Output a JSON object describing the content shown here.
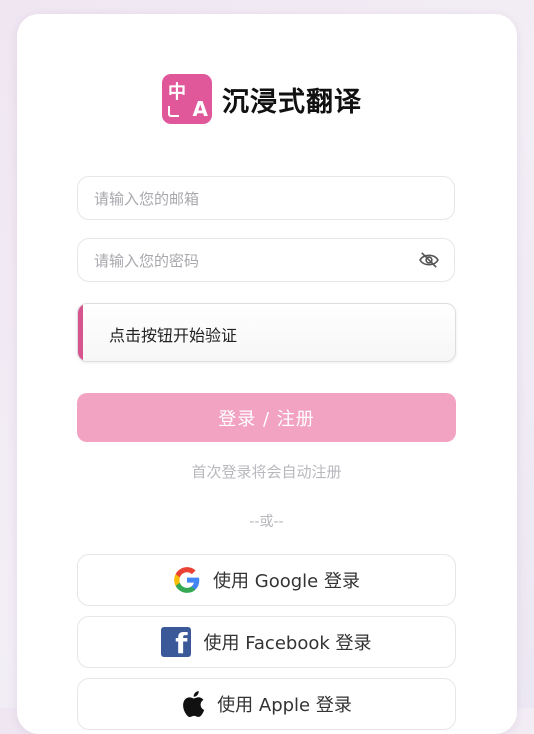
{
  "brand": {
    "logo_zh": "中",
    "logo_a": "A",
    "name": "沉浸式翻译"
  },
  "form": {
    "email_placeholder": "请输入您的邮箱",
    "password_placeholder": "请输入您的密码",
    "verify_label": "点击按钮开始验证",
    "submit_label": "登录 / 注册",
    "hint": "首次登录将会自动注册",
    "divider": "--或--"
  },
  "social": {
    "google_label": "使用 Google 登录",
    "facebook_label": "使用 Facebook 登录",
    "apple_label": "使用 Apple 登录"
  },
  "colors": {
    "accent": "#e0589a",
    "button": "#f1a3c1",
    "facebook": "#3b5998"
  },
  "icons": [
    "translate-logo-icon",
    "eye-off-icon",
    "google-icon",
    "facebook-icon",
    "apple-icon"
  ]
}
